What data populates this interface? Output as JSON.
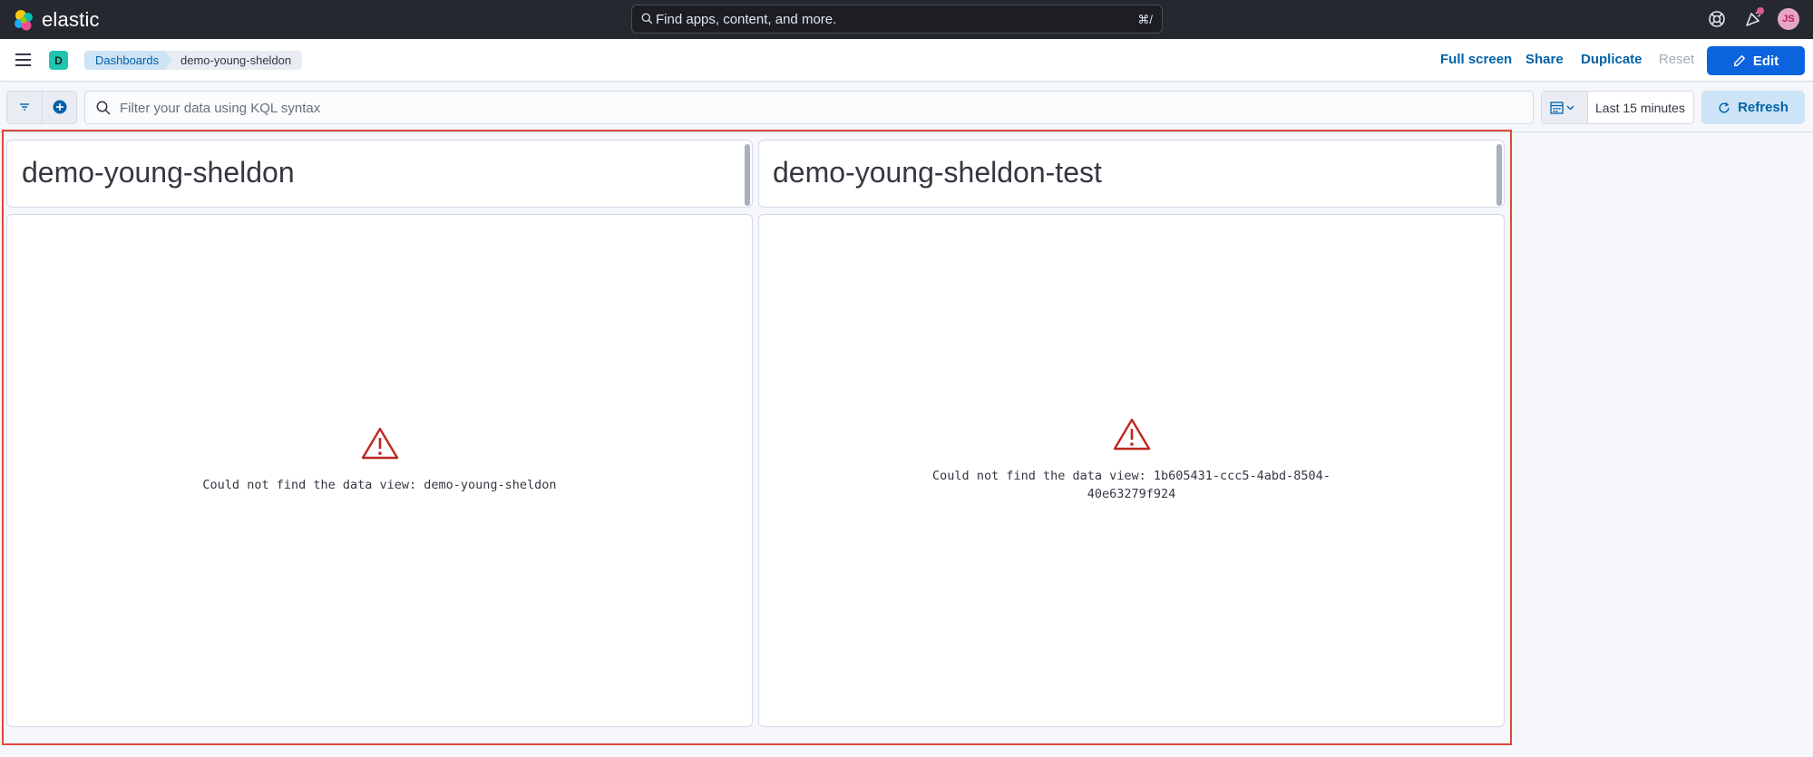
{
  "app": {
    "brand": "elastic",
    "search_placeholder": "Find apps, content, and more.",
    "search_shortcut": "⌘/",
    "user_initials": "JS"
  },
  "nav": {
    "space_initial": "D",
    "breadcrumbs": [
      "Dashboards",
      "demo-young-sheldon"
    ],
    "actions": {
      "full_screen": "Full screen",
      "share": "Share",
      "duplicate": "Duplicate",
      "reset": "Reset",
      "edit": "Edit"
    }
  },
  "query": {
    "placeholder": "Filter your data using KQL syntax",
    "time_range": "Last 15 minutes",
    "refresh": "Refresh"
  },
  "panels": [
    {
      "title": "demo-young-sheldon",
      "error": "Could not find the data view: demo-young-sheldon"
    },
    {
      "title": "demo-young-sheldon-test",
      "error_line1": "Could not find the data view: 1b605431-ccc5-4abd-8504-",
      "error_line2": "40e63279f924"
    }
  ],
  "colors": {
    "header_bg": "#25282f",
    "primary": "#0b64dd",
    "link": "#0061a6",
    "danger": "#bd271e",
    "highlight_outline": "#e0483a"
  }
}
